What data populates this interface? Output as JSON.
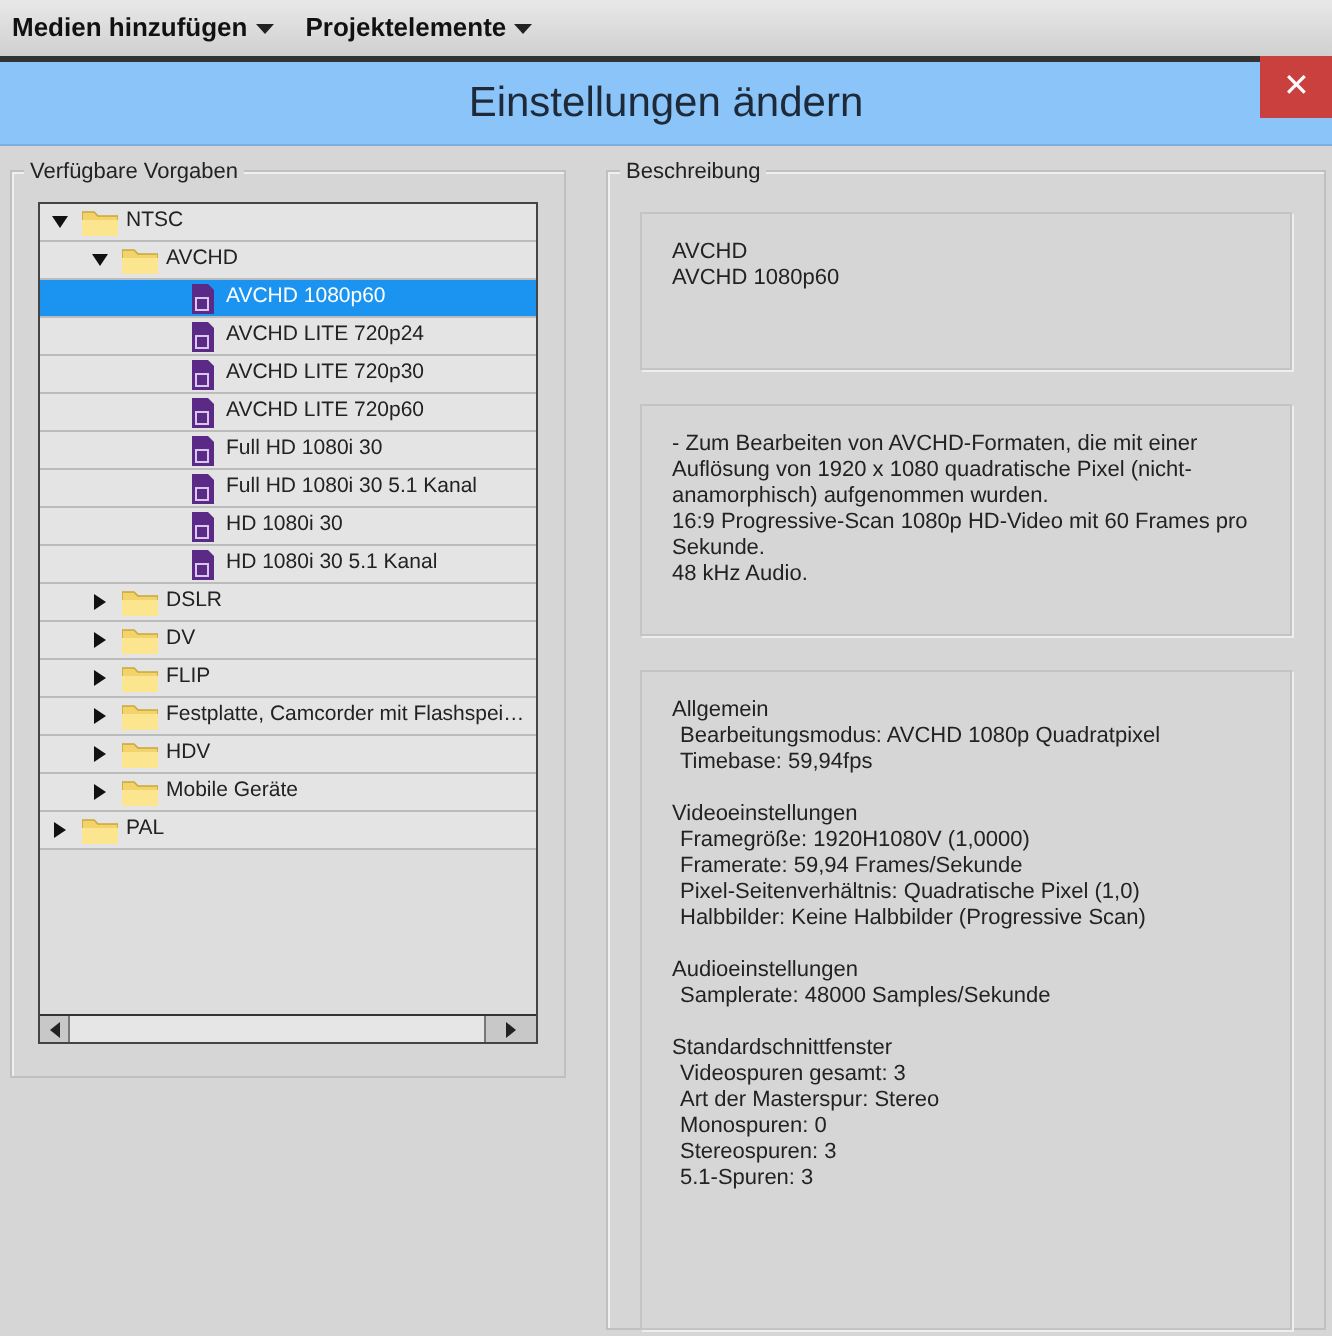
{
  "menu_bar": [
    "Medien hinzufügen",
    "Projektelemente"
  ],
  "dialog": {
    "title": "Einstellungen ändern",
    "close": "✕"
  },
  "presets": {
    "label": "Verfügbare Vorgaben",
    "tree": [
      {
        "label": "NTSC",
        "kind": "folder",
        "expanded": true,
        "selected": false,
        "children": [
          {
            "label": "AVCHD",
            "kind": "folder",
            "expanded": true,
            "selected": false,
            "children": [
              {
                "label": "AVCHD 1080p60",
                "kind": "preset",
                "selected": true
              },
              {
                "label": "AVCHD LITE 720p24",
                "kind": "preset",
                "selected": false
              },
              {
                "label": "AVCHD LITE 720p30",
                "kind": "preset",
                "selected": false
              },
              {
                "label": "AVCHD LITE 720p60",
                "kind": "preset",
                "selected": false
              },
              {
                "label": "Full HD 1080i 30",
                "kind": "preset",
                "selected": false
              },
              {
                "label": "Full HD 1080i 30 5.1 Kanal",
                "kind": "preset",
                "selected": false
              },
              {
                "label": "HD 1080i 30",
                "kind": "preset",
                "selected": false
              },
              {
                "label": "HD 1080i 30 5.1 Kanal",
                "kind": "preset",
                "selected": false
              }
            ]
          },
          {
            "label": "DSLR",
            "kind": "folder",
            "expanded": false,
            "selected": false
          },
          {
            "label": "DV",
            "kind": "folder",
            "expanded": false,
            "selected": false
          },
          {
            "label": "FLIP",
            "kind": "folder",
            "expanded": false,
            "selected": false
          },
          {
            "label": "Festplatte, Camcorder mit Flashspei…",
            "kind": "folder",
            "expanded": false,
            "selected": false
          },
          {
            "label": "HDV",
            "kind": "folder",
            "expanded": false,
            "selected": false
          },
          {
            "label": "Mobile Geräte",
            "kind": "folder",
            "expanded": false,
            "selected": false
          }
        ]
      },
      {
        "label": "PAL",
        "kind": "folder",
        "expanded": false,
        "selected": false
      }
    ]
  },
  "description": {
    "label": "Beschreibung",
    "name_lines": [
      "AVCHD",
      "AVCHD 1080p60"
    ],
    "details": [
      "- Zum Bearbeiten von AVCHD-Formaten, die mit einer Auflösung von 1920 x 1080 quadratische Pixel (nicht-anamorphisch) aufgenommen wurden.",
      "16:9 Progressive-Scan 1080p HD-Video mit 60 Frames pro Sekunde.",
      "48 kHz Audio."
    ],
    "settings": [
      {
        "heading": "Allgemein",
        "items": [
          "Bearbeitungsmodus: AVCHD 1080p Quadratpixel",
          "Timebase: 59,94fps"
        ]
      },
      {
        "heading": "Videoeinstellungen",
        "items": [
          "Framegröße: 1920H1080V (1,0000)",
          "Framerate: 59,94 Frames/Sekunde",
          "Pixel-Seitenverhältnis: Quadratische Pixel (1,0)",
          "Halbbilder: Keine Halbbilder (Progressive Scan)"
        ]
      },
      {
        "heading": "Audioeinstellungen",
        "items": [
          "Samplerate: 48000 Samples/Sekunde"
        ]
      },
      {
        "heading": "Standardschnittfenster",
        "items": [
          "Videospuren gesamt: 3",
          "Art der Masterspur: Stereo",
          "Monospuren: 0",
          "Stereospuren: 3",
          "5.1-Spuren: 3"
        ]
      }
    ]
  }
}
